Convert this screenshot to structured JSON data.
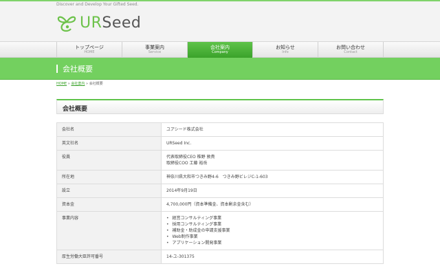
{
  "header": {
    "tagline": "Discover and Develop Your Gifted Seed.",
    "logo_ur": "UR",
    "logo_rest": "Seed",
    "brand_color": "#6cc24a"
  },
  "nav": {
    "items": [
      {
        "jp": "トップページ",
        "en": "HOME"
      },
      {
        "jp": "事業案内",
        "en": "Service"
      },
      {
        "jp": "会社案内",
        "en": "Company"
      },
      {
        "jp": "お知らせ",
        "en": "Info"
      },
      {
        "jp": "お問い合わせ",
        "en": "Contact"
      }
    ],
    "active_color": "#4fb53b"
  },
  "banner": {
    "title": "会社概要"
  },
  "breadcrumb": {
    "home": "HOME",
    "sep1": " » ",
    "company": "会社案内",
    "sep2": " » ",
    "current": "会社概要"
  },
  "section": {
    "title": "会社概要"
  },
  "table": {
    "rows": [
      {
        "label": "会社名",
        "value": "ユアシード株式会社"
      },
      {
        "label": "英文社名",
        "value": "URSeed Inc."
      },
      {
        "label": "役員",
        "lines": [
          "代表取締役CEO 椎野 敦貴",
          "取締役COO 工藤 裕岳"
        ]
      },
      {
        "label": "所在地",
        "value": "神奈川県大和市つきみ野4-6　つきみ野ビレジC-1-603"
      },
      {
        "label": "設立",
        "value": "2014年9月19日"
      },
      {
        "label": "資本金",
        "value": "4,700,000円（資本準備金、資本剰余金含む）"
      },
      {
        "label": "事業内容",
        "items": [
          "経営コンサルティング事業",
          "採用コンサルティング事業",
          "補助金・助成金の申請支援事業",
          "Web制作事業",
          "アプリケーション開発事業"
        ]
      },
      {
        "label": "厚生労働大臣許可番号",
        "value": "14-ユ-301375"
      }
    ]
  }
}
